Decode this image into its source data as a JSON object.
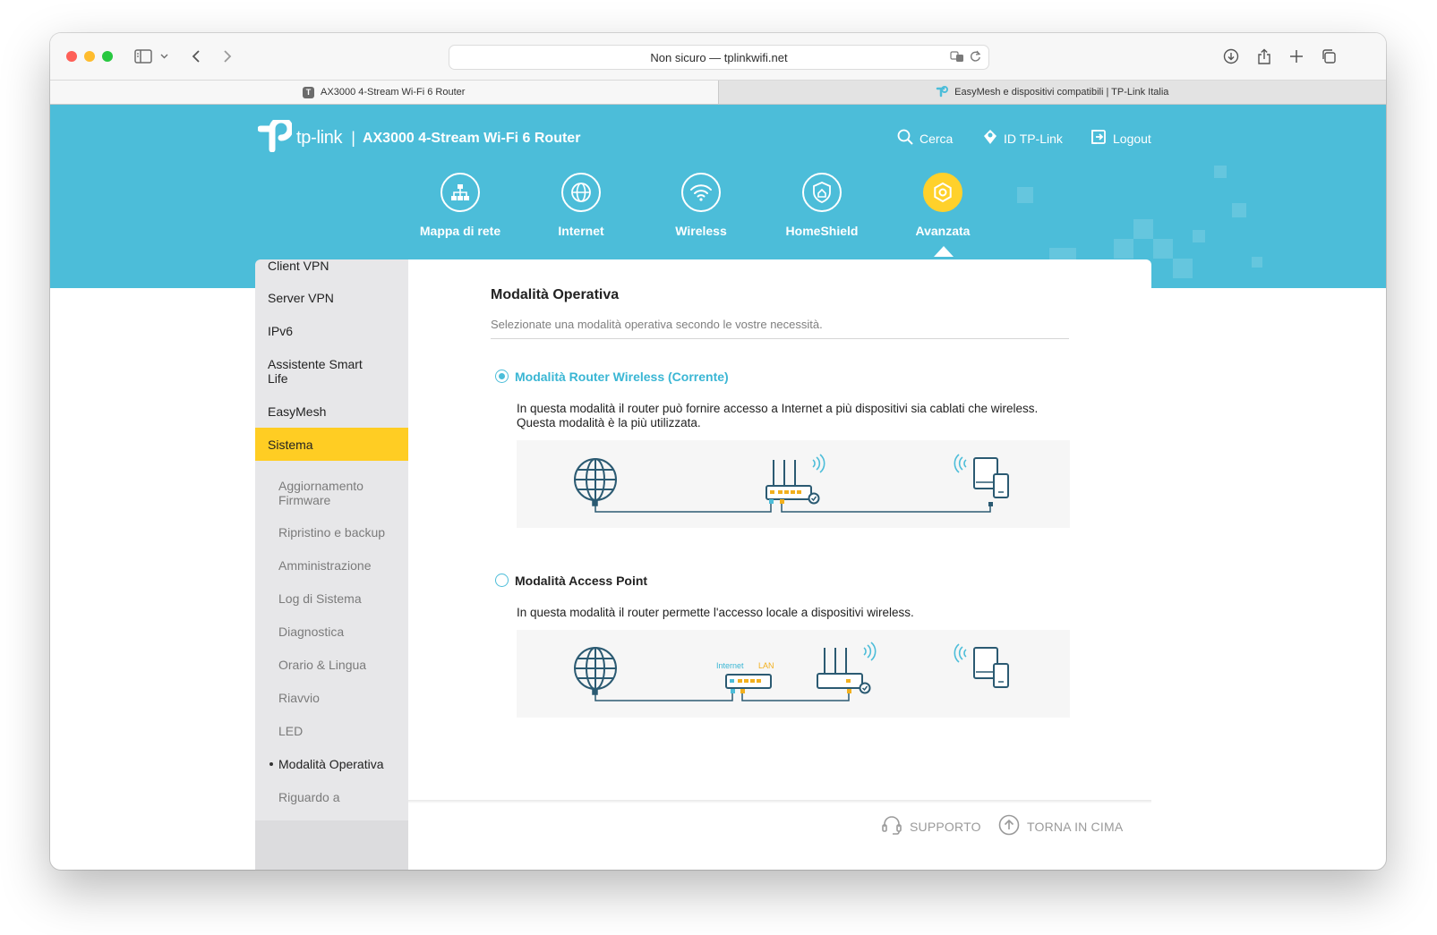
{
  "browser": {
    "url": "Non sicuro — tplinkwifi.net",
    "tabs": [
      {
        "title": "AX3000 4-Stream Wi-Fi 6 Router",
        "favicon": "T"
      },
      {
        "title": "EasyMesh e dispositivi compatibili | TP-Link Italia"
      }
    ]
  },
  "header": {
    "brand": "tp-link",
    "separator": "|",
    "model": "AX3000 4-Stream Wi-Fi 6 Router",
    "links": {
      "search": "Cerca",
      "tplink_id": "ID TP-Link",
      "logout": "Logout"
    }
  },
  "nav": {
    "items": [
      {
        "label": "Mappa di rete",
        "icon": "network-map-icon"
      },
      {
        "label": "Internet",
        "icon": "globe-icon"
      },
      {
        "label": "Wireless",
        "icon": "wifi-icon"
      },
      {
        "label": "HomeShield",
        "icon": "home-shield-icon"
      },
      {
        "label": "Avanzata",
        "icon": "gear-icon"
      }
    ],
    "active": "Avanzata"
  },
  "sidebar": {
    "items": [
      "Client VPN",
      "Server VPN",
      "IPv6",
      "Assistente Smart Life",
      "EasyMesh",
      "Sistema"
    ],
    "selected": "Sistema",
    "subitems": [
      "Aggiornamento Firmware",
      "Ripristino e backup",
      "Amministrazione",
      "Log di Sistema",
      "Diagnostica",
      "Orario & Lingua",
      "Riavvio",
      "LED",
      "Modalità Operativa",
      "Riguardo a"
    ],
    "current_subitem": "Modalità Operativa"
  },
  "content": {
    "title": "Modalità Operativa",
    "subtitle": "Selezionate una modalità operativa secondo le vostre necessità.",
    "options": [
      {
        "label": "Modalità Router Wireless (Corrente)",
        "selected": true,
        "desc_line1": "In questa modalità il router può fornire accesso a Internet a più dispositivi sia cablati che wireless.",
        "desc_line2": "Questa modalità è la più utilizzata."
      },
      {
        "label": "Modalità Access Point",
        "selected": false,
        "desc_line1": "In questa modalità il router permette l'accesso locale a dispositivi wireless.",
        "diagram_labels": {
          "internet": "Internet",
          "lan": "LAN"
        }
      }
    ]
  },
  "footer": {
    "support": "SUPPORTO",
    "back_to_top": "TORNA IN CIMA"
  },
  "colors": {
    "accent": "#4cbdd9",
    "highlight": "#ffcd23",
    "diagram_line": "#2b5a72"
  }
}
